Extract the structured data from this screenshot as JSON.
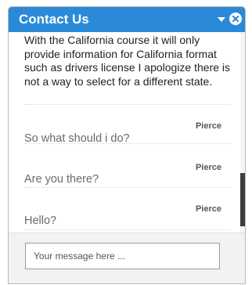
{
  "header": {
    "title": "Contact Us",
    "color": "#2b8ad8",
    "minimize_icon": "chevron-down-icon",
    "close_icon": "close-circle-icon"
  },
  "messages": [
    {
      "sender": "",
      "text": "With the California course it will only provide information for California format such as drivers license I apologize there is not a way to select for a different state."
    },
    {
      "sender": "Pierce",
      "text": "So what should i do?"
    },
    {
      "sender": "Pierce",
      "text": "Are you there?"
    },
    {
      "sender": "Pierce",
      "text": "Hello?"
    }
  ],
  "composer": {
    "placeholder": "Your message here ...",
    "value": ""
  }
}
